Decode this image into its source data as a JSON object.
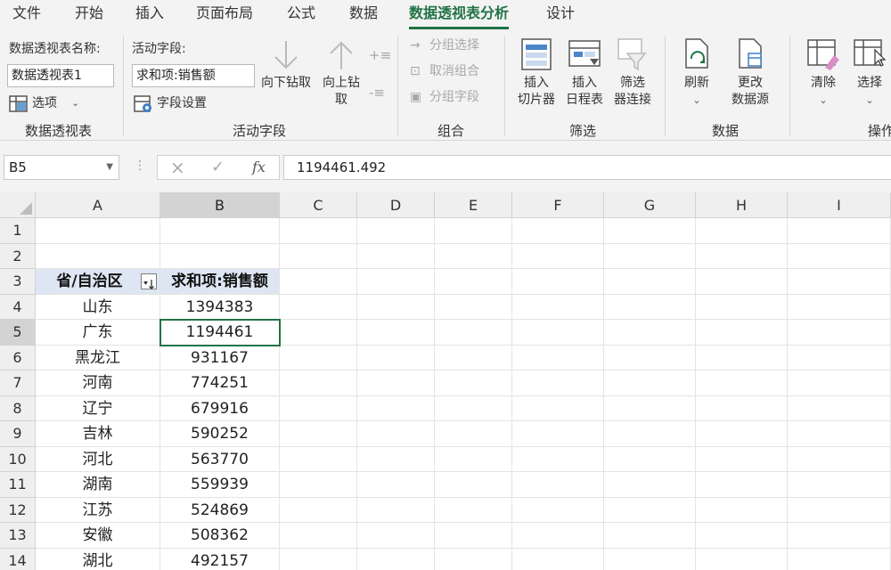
{
  "tabs": [
    "文件",
    "开始",
    "插入",
    "页面布局",
    "公式",
    "数据",
    "数据透视表分析",
    "设计"
  ],
  "ribbon": {
    "pivot_group": {
      "name_label": "数据透视表名称:",
      "name_value": "数据透视表1",
      "options_label": "选项",
      "group_label": "数据透视表"
    },
    "field_group": {
      "active_field_label": "活动字段:",
      "active_field_value": "求和项:销售额",
      "field_settings_label": "字段设置",
      "drill_down": "向下钻取",
      "drill_up_line1": "向上钻",
      "drill_up_line2": "取",
      "group_label": "活动字段"
    },
    "combine_group": {
      "group_selection": "分组选择",
      "ungroup": "取消组合",
      "group_field": "分组字段",
      "group_label": "组合"
    },
    "filter_group": {
      "slicer_line1": "插入",
      "slicer_line2": "切片器",
      "timeline_line1": "插入",
      "timeline_line2": "日程表",
      "connections_line1": "筛选",
      "connections_line2": "器连接",
      "group_label": "筛选"
    },
    "data_group": {
      "refresh": "刷新",
      "change_source_line1": "更改",
      "change_source_line2": "数据源",
      "group_label": "数据"
    },
    "actions_group": {
      "clear": "清除",
      "select": "选择",
      "group_label": "操作"
    }
  },
  "formula_bar": {
    "name_box": "B5",
    "cancel_icon": "×",
    "enter_icon": "✓",
    "fx_icon": "fx",
    "formula": "1194461.492"
  },
  "sheet": {
    "columns": [
      "A",
      "B",
      "C",
      "D",
      "E",
      "F",
      "G",
      "H",
      "I"
    ],
    "rows": [
      "1",
      "2",
      "3",
      "4",
      "5",
      "6",
      "7",
      "8",
      "9",
      "10",
      "11",
      "12",
      "13",
      "14"
    ],
    "selected_cell": "B5",
    "pivot": {
      "header_province": "省/自治区",
      "header_sum": "求和项:销售额",
      "records": [
        {
          "province": "山东",
          "sales": "1394383"
        },
        {
          "province": "广东",
          "sales": "1194461"
        },
        {
          "province": "黑龙江",
          "sales": "931167"
        },
        {
          "province": "河南",
          "sales": "774251"
        },
        {
          "province": "辽宁",
          "sales": "679916"
        },
        {
          "province": "吉林",
          "sales": "590252"
        },
        {
          "province": "河北",
          "sales": "563770"
        },
        {
          "province": "湖南",
          "sales": "559939"
        },
        {
          "province": "江苏",
          "sales": "524869"
        },
        {
          "province": "安徽",
          "sales": "508362"
        },
        {
          "province": "湖北",
          "sales": "492157"
        }
      ]
    }
  },
  "colors": {
    "accent": "#217346",
    "pivot_header_fill": "#dde6f2"
  }
}
